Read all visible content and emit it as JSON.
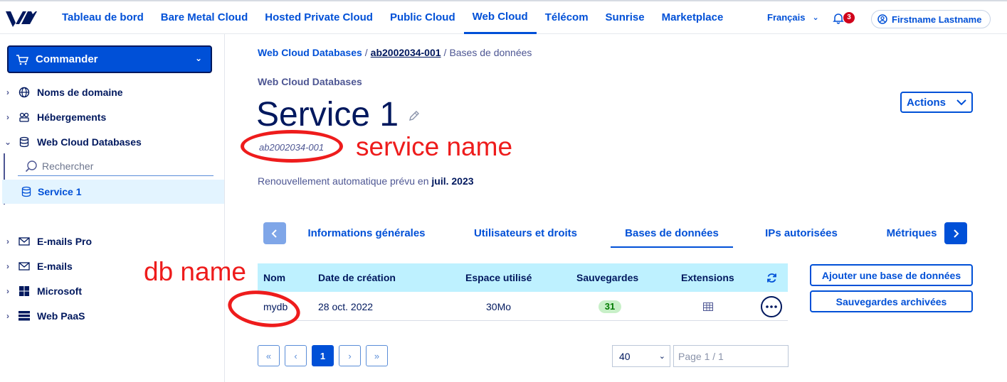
{
  "topbar": {
    "nav": [
      "Tableau de bord",
      "Bare Metal Cloud",
      "Hosted Private Cloud",
      "Public Cloud",
      "Web Cloud",
      "Télécom",
      "Sunrise",
      "Marketplace"
    ],
    "active_nav": "Web Cloud",
    "language": "Français",
    "notifications_count": "3",
    "user_name": "Firstname Lastname"
  },
  "sidebar": {
    "order_label": "Commander",
    "items": [
      {
        "label": "Noms de domaine",
        "icon": "globe-icon"
      },
      {
        "label": "Hébergements",
        "icon": "hosting-icon"
      },
      {
        "label": "Web Cloud Databases",
        "icon": "database-icon"
      },
      {
        "label": "E-mails Pro",
        "icon": "mail-icon"
      },
      {
        "label": "E-mails",
        "icon": "mail-icon"
      },
      {
        "label": "Microsoft",
        "icon": "windows-icon"
      },
      {
        "label": "Web PaaS",
        "icon": "stack-icon"
      }
    ],
    "search_placeholder": "Rechercher",
    "service_label": "Service 1"
  },
  "main": {
    "breadcrumb": [
      "Web Cloud Databases",
      "ab2002034-001",
      "Bases de données"
    ],
    "breadcrumb_sep": "/",
    "section_label": "Web Cloud Databases",
    "title": "Service 1",
    "service_id": "ab2002034-001",
    "actions_label": "Actions",
    "renewal_text": "Renouvellement automatique prévu en",
    "renewal_date": "juil. 2023",
    "tabs": [
      "Informations générales",
      "Utilisateurs et droits",
      "Bases de données",
      "IPs autorisées",
      "Métriques"
    ],
    "active_tab": "Bases de données",
    "table": {
      "headers": [
        "Nom",
        "Date de création",
        "Espace utilisé",
        "Sauvegardes",
        "Extensions"
      ],
      "rows": [
        {
          "name": "mydb",
          "created": "28 oct. 2022",
          "space": "30Mo",
          "backups": "31"
        }
      ]
    },
    "buttons": {
      "add_db": "Ajouter une base de données",
      "archived_backups": "Sauvegardes archivées"
    },
    "pagination": {
      "first": "«",
      "prev": "‹",
      "current": "1",
      "next": "›",
      "last": "»",
      "per_page": "40",
      "page_label": "Page 1 / 1"
    }
  },
  "annotations": {
    "service_name": "service name",
    "db_name": "db name",
    "color": "#ee1c1c"
  },
  "colors": {
    "primary": "#0050d7",
    "dark": "#00185e",
    "table_header": "#bef1ff",
    "selected_row": "#e3f4ff"
  }
}
